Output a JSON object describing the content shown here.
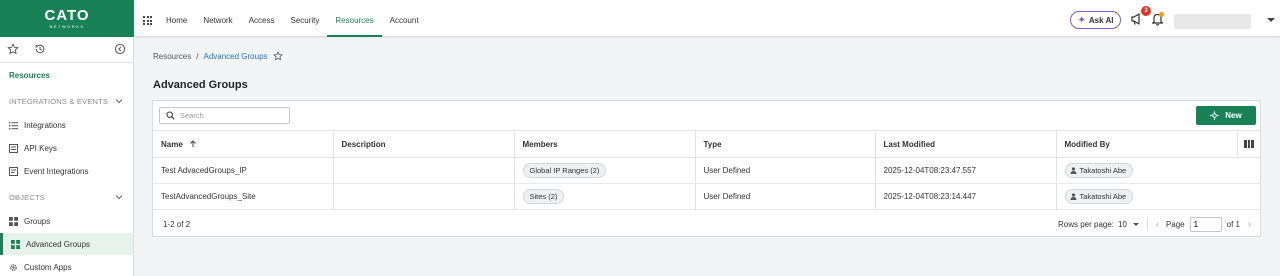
{
  "logo": {
    "brand": "CATO",
    "sub": "NETWORKS"
  },
  "nav": {
    "items": [
      {
        "label": "Home"
      },
      {
        "label": "Network"
      },
      {
        "label": "Access"
      },
      {
        "label": "Security"
      },
      {
        "label": "Resources",
        "active": true
      },
      {
        "label": "Account"
      }
    ]
  },
  "header": {
    "ask_ai": "Ask AI",
    "notification_count": "3"
  },
  "sidebar": {
    "current_section": "Resources",
    "sections": [
      {
        "label": "INTEGRATIONS & EVENTS"
      },
      {
        "label": "OBJECTS"
      }
    ],
    "items": [
      {
        "label": "Integrations",
        "icon": "list-icon"
      },
      {
        "label": "API Keys",
        "icon": "key-doc-icon"
      },
      {
        "label": "Event Integrations",
        "icon": "doc-icon"
      },
      {
        "label": "Groups",
        "icon": "grid-icon"
      },
      {
        "label": "Advanced Groups",
        "icon": "grid-icon",
        "active": true
      },
      {
        "label": "Custom Apps",
        "icon": "gear-icon"
      }
    ]
  },
  "breadcrumb": {
    "root": "Resources",
    "separator": "/",
    "current": "Advanced Groups"
  },
  "page": {
    "title": "Advanced Groups"
  },
  "toolbar": {
    "search_placeholder": "Search",
    "new_label": "New"
  },
  "table": {
    "columns": [
      "Name",
      "Description",
      "Members",
      "Type",
      "Last Modified",
      "Modified By"
    ],
    "rows": [
      {
        "name": "Test AdvacedGroups_IP",
        "description": "",
        "members": "Global IP Ranges (2)",
        "type": "User Defined",
        "last_modified": "2025-12-04T08:23:47.557",
        "modified_by": "Takatoshi Abe"
      },
      {
        "name": "TestAdvancedGroups_Site",
        "description": "",
        "members": "Sites (2)",
        "type": "User Defined",
        "last_modified": "2025-12-04T08:23:14.447",
        "modified_by": "Takatoshi Abe"
      }
    ]
  },
  "footer": {
    "count": "1-2 of 2",
    "rows_per_page_label": "Rows per page:",
    "rows_per_page_value": "10",
    "page_label": "Page",
    "page_value": "1",
    "of_label": "of 1"
  },
  "colors": {
    "brand": "#188256",
    "link": "#1f78c8",
    "ai_accent": "#7c5cd6",
    "badge": "#e0352b"
  }
}
